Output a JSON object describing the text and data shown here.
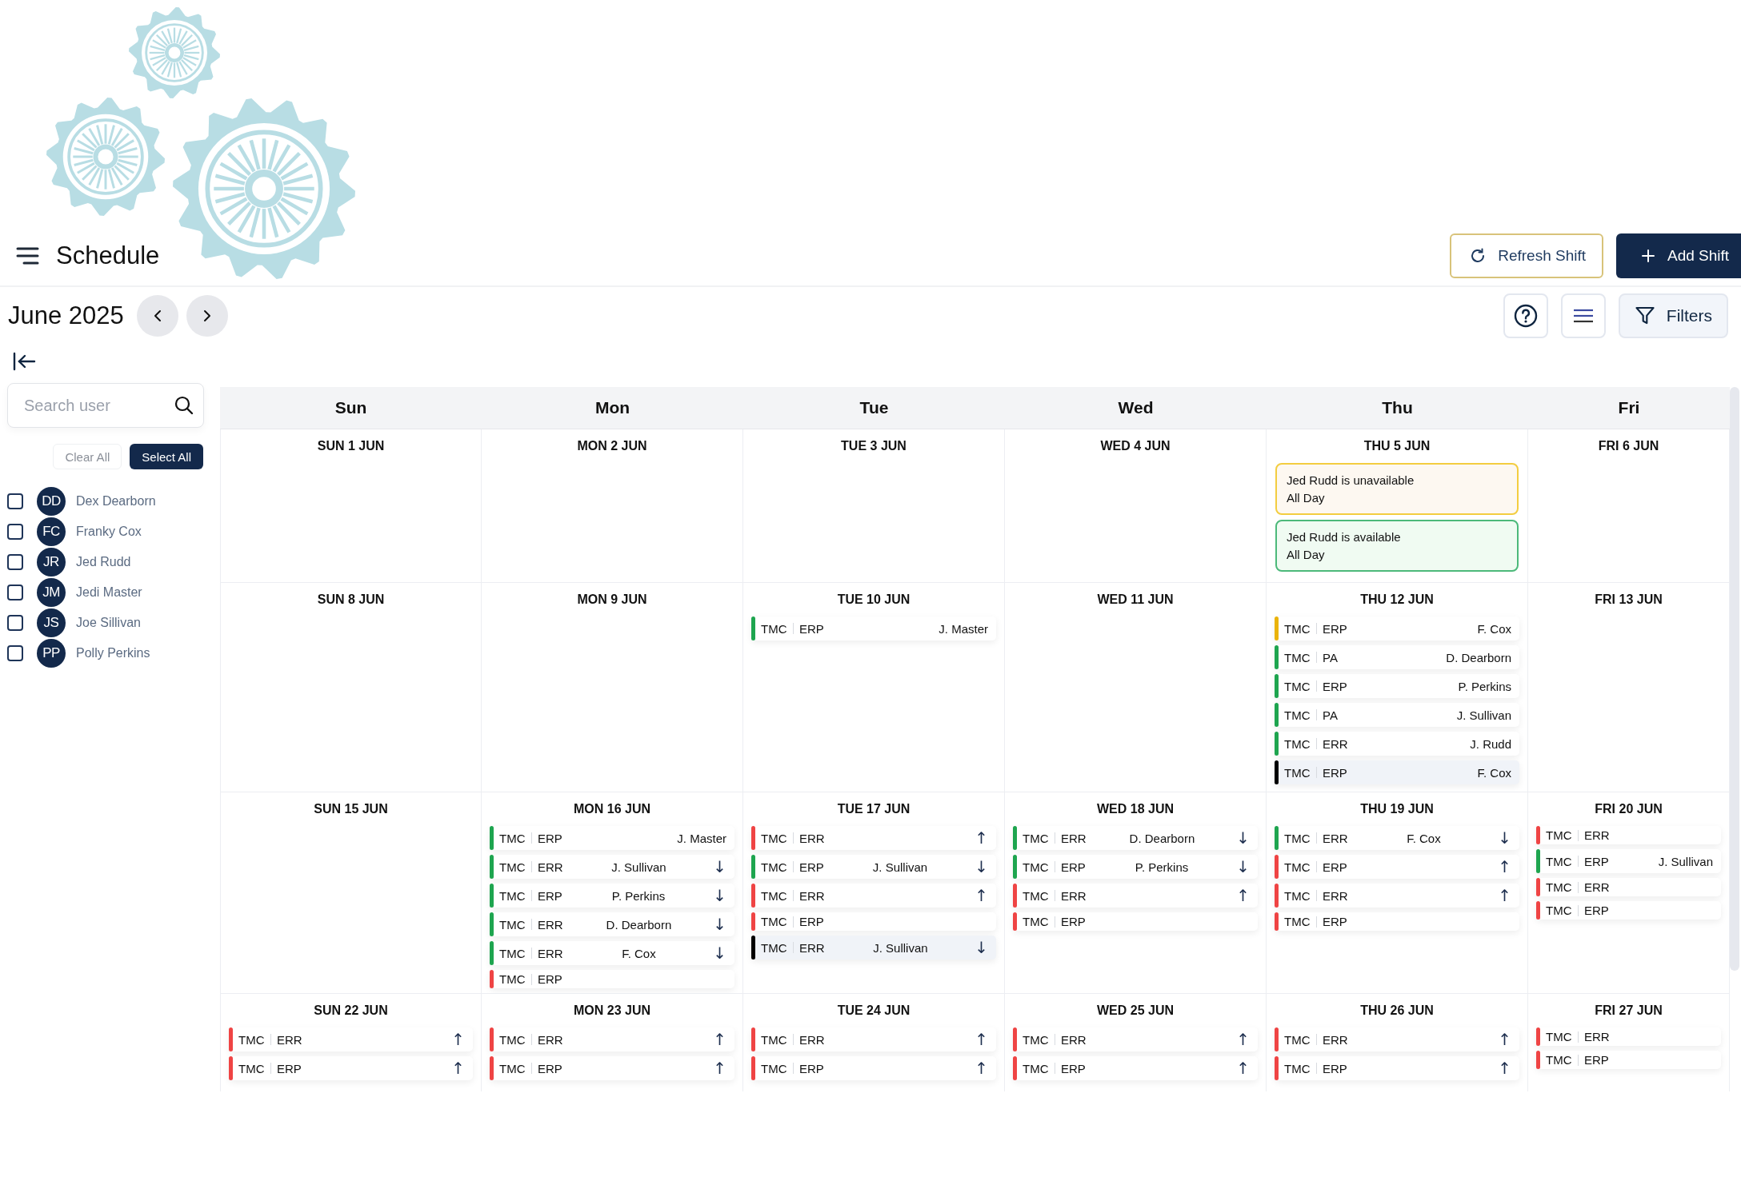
{
  "header": {
    "title": "Schedule",
    "buttons": [
      {
        "label": "Refresh Shift",
        "kind": "outline"
      },
      {
        "label": "Add Shift",
        "kind": "primary"
      }
    ]
  },
  "toolbar": {
    "month": "June 2025",
    "filters_label": "Filters"
  },
  "sidebar": {
    "search": {
      "placeholder": "Search user"
    },
    "clear_label": "Clear All",
    "select_label": "Select All",
    "users": [
      {
        "initials": "DD",
        "name": "Dex Dearborn",
        "checked": false
      },
      {
        "initials": "FC",
        "name": "Franky Cox",
        "checked": false
      },
      {
        "initials": "JR",
        "name": "Jed Rudd",
        "checked": false
      },
      {
        "initials": "JM",
        "name": "Jedi Master",
        "checked": false
      },
      {
        "initials": "JS",
        "name": "Joe Sillivan",
        "checked": false
      },
      {
        "initials": "PP",
        "name": "Polly Perkins",
        "checked": false
      }
    ]
  },
  "calendar": {
    "columns": [
      "Sun",
      "Mon",
      "Tue",
      "Wed",
      "Thu",
      "Fri"
    ],
    "weeks": [
      [
        {
          "label": "SUN 1 JUN"
        },
        {
          "label": "MON 2 JUN"
        },
        {
          "label": "TUE 3 JUN"
        },
        {
          "label": "WED 4 JUN"
        },
        {
          "label": "THU 5 JUN",
          "notes": [
            {
              "text": "Jed Rudd is unavailable",
              "sub": "All Day",
              "kind": "unavailable"
            },
            {
              "text": "Jed Rudd is available",
              "sub": "All Day",
              "kind": "available"
            }
          ]
        },
        {
          "label": "FRI 6 JUN"
        }
      ],
      [
        {
          "label": "SUN 8 JUN"
        },
        {
          "label": "MON 9 JUN"
        },
        {
          "label": "TUE 10 JUN",
          "shifts": [
            {
              "dept": "TMC",
              "code": "ERP",
              "person": "J. Master",
              "color": "#1ea54f",
              "highlighted": false
            }
          ]
        },
        {
          "label": "WED 11 JUN"
        },
        {
          "label": "THU 12 JUN",
          "shifts": [
            {
              "dept": "TMC",
              "code": "ERP",
              "person": "F. Cox",
              "color": "#eab308",
              "highlighted": false
            },
            {
              "dept": "TMC",
              "code": "PA",
              "person": "D. Dearborn",
              "color": "#1ea54f",
              "highlighted": false
            },
            {
              "dept": "TMC",
              "code": "ERP",
              "person": "P. Perkins",
              "color": "#1ea54f",
              "highlighted": false
            },
            {
              "dept": "TMC",
              "code": "PA",
              "person": "J. Sullivan",
              "color": "#1ea54f",
              "highlighted": false
            },
            {
              "dept": "TMC",
              "code": "ERR",
              "person": "J. Rudd",
              "color": "#1ea54f",
              "highlighted": false
            },
            {
              "dept": "TMC",
              "code": "ERP",
              "person": "F. Cox",
              "color": "#000000",
              "highlighted": true
            }
          ]
        },
        {
          "label": "FRI 13 JUN"
        }
      ],
      [
        {
          "label": "SUN 15 JUN"
        },
        {
          "label": "MON 16 JUN",
          "shifts": [
            {
              "dept": "TMC",
              "code": "ERP",
              "person": "J. Master",
              "color": "#1ea54f",
              "highlighted": false
            },
            {
              "dept": "TMC",
              "code": "ERR",
              "person": "J. Sullivan",
              "arrow": "↓",
              "color": "#1ea54f",
              "highlighted": false
            },
            {
              "dept": "TMC",
              "code": "ERP",
              "person": "P. Perkins",
              "arrow": "↓",
              "color": "#1ea54f",
              "highlighted": false
            },
            {
              "dept": "TMC",
              "code": "ERR",
              "person": "D. Dearborn",
              "arrow": "↓",
              "color": "#1ea54f",
              "highlighted": false
            },
            {
              "dept": "TMC",
              "code": "ERR",
              "person": "F. Cox",
              "arrow": "↓",
              "color": "#1ea54f",
              "highlighted": false
            },
            {
              "dept": "TMC",
              "code": "ERP",
              "color": "#ef4444",
              "highlighted": false
            }
          ]
        },
        {
          "label": "TUE 17 JUN",
          "shifts": [
            {
              "dept": "TMC",
              "code": "ERR",
              "arrow": "↑",
              "color": "#ef4444",
              "highlighted": false
            },
            {
              "dept": "TMC",
              "code": "ERP",
              "person": "J. Sullivan",
              "arrow": "↓",
              "color": "#1ea54f",
              "highlighted": false
            },
            {
              "dept": "TMC",
              "code": "ERR",
              "arrow": "↑",
              "color": "#ef4444",
              "highlighted": false
            },
            {
              "dept": "TMC",
              "code": "ERP",
              "color": "#ef4444",
              "highlighted": false
            },
            {
              "dept": "TMC",
              "code": "ERR",
              "person": "J. Sullivan",
              "arrow": "↓",
              "color": "#000000",
              "highlighted": true
            }
          ]
        },
        {
          "label": "WED 18 JUN",
          "shifts": [
            {
              "dept": "TMC",
              "code": "ERR",
              "person": "D. Dearborn",
              "arrow": "↓",
              "color": "#1ea54f",
              "highlighted": false
            },
            {
              "dept": "TMC",
              "code": "ERP",
              "person": "P. Perkins",
              "arrow": "↓",
              "color": "#1ea54f",
              "highlighted": false
            },
            {
              "dept": "TMC",
              "code": "ERR",
              "arrow": "↑",
              "color": "#ef4444",
              "highlighted": false
            },
            {
              "dept": "TMC",
              "code": "ERP",
              "color": "#ef4444",
              "highlighted": false
            }
          ]
        },
        {
          "label": "THU 19 JUN",
          "shifts": [
            {
              "dept": "TMC",
              "code": "ERR",
              "person": "F. Cox",
              "arrow": "↓",
              "color": "#1ea54f",
              "highlighted": false
            },
            {
              "dept": "TMC",
              "code": "ERP",
              "arrow": "↑",
              "color": "#ef4444",
              "highlighted": false
            },
            {
              "dept": "TMC",
              "code": "ERR",
              "arrow": "↑",
              "color": "#ef4444",
              "highlighted": false
            },
            {
              "dept": "TMC",
              "code": "ERP",
              "color": "#ef4444",
              "highlighted": false
            }
          ]
        },
        {
          "label": "FRI 20 JUN",
          "shifts": [
            {
              "dept": "TMC",
              "code": "ERR",
              "color": "#ef4444",
              "highlighted": false
            },
            {
              "dept": "TMC",
              "code": "ERP",
              "person": "J. Sullivan",
              "color": "#1ea54f",
              "highlighted": false
            },
            {
              "dept": "TMC",
              "code": "ERR",
              "color": "#ef4444",
              "highlighted": false
            },
            {
              "dept": "TMC",
              "code": "ERP",
              "color": "#ef4444",
              "highlighted": false
            }
          ]
        }
      ],
      [
        {
          "label": "SUN 22 JUN",
          "shifts": [
            {
              "dept": "TMC",
              "code": "ERR",
              "arrow": "↑",
              "color": "#ef4444",
              "highlighted": false
            },
            {
              "dept": "TMC",
              "code": "ERP",
              "arrow": "↑",
              "color": "#ef4444",
              "highlighted": false
            }
          ]
        },
        {
          "label": "MON 23 JUN",
          "shifts": [
            {
              "dept": "TMC",
              "code": "ERR",
              "arrow": "↑",
              "color": "#ef4444",
              "highlighted": false
            },
            {
              "dept": "TMC",
              "code": "ERP",
              "arrow": "↑",
              "color": "#ef4444",
              "highlighted": false
            }
          ]
        },
        {
          "label": "TUE 24 JUN",
          "shifts": [
            {
              "dept": "TMC",
              "code": "ERR",
              "arrow": "↑",
              "color": "#ef4444",
              "highlighted": false
            },
            {
              "dept": "TMC",
              "code": "ERP",
              "arrow": "↑",
              "color": "#ef4444",
              "highlighted": false
            }
          ]
        },
        {
          "label": "WED 25 JUN",
          "shifts": [
            {
              "dept": "TMC",
              "code": "ERR",
              "arrow": "↑",
              "color": "#ef4444",
              "highlighted": false
            },
            {
              "dept": "TMC",
              "code": "ERP",
              "arrow": "↑",
              "color": "#ef4444",
              "highlighted": false
            }
          ]
        },
        {
          "label": "THU 26 JUN",
          "shifts": [
            {
              "dept": "TMC",
              "code": "ERR",
              "arrow": "↑",
              "color": "#ef4444",
              "highlighted": false
            },
            {
              "dept": "TMC",
              "code": "ERP",
              "arrow": "↑",
              "color": "#ef4444",
              "highlighted": false
            }
          ]
        },
        {
          "label": "FRI 27 JUN",
          "shifts": [
            {
              "dept": "TMC",
              "code": "ERR",
              "color": "#ef4444",
              "highlighted": false
            },
            {
              "dept": "TMC",
              "code": "ERP",
              "color": "#ef4444",
              "highlighted": false
            }
          ]
        }
      ]
    ]
  }
}
